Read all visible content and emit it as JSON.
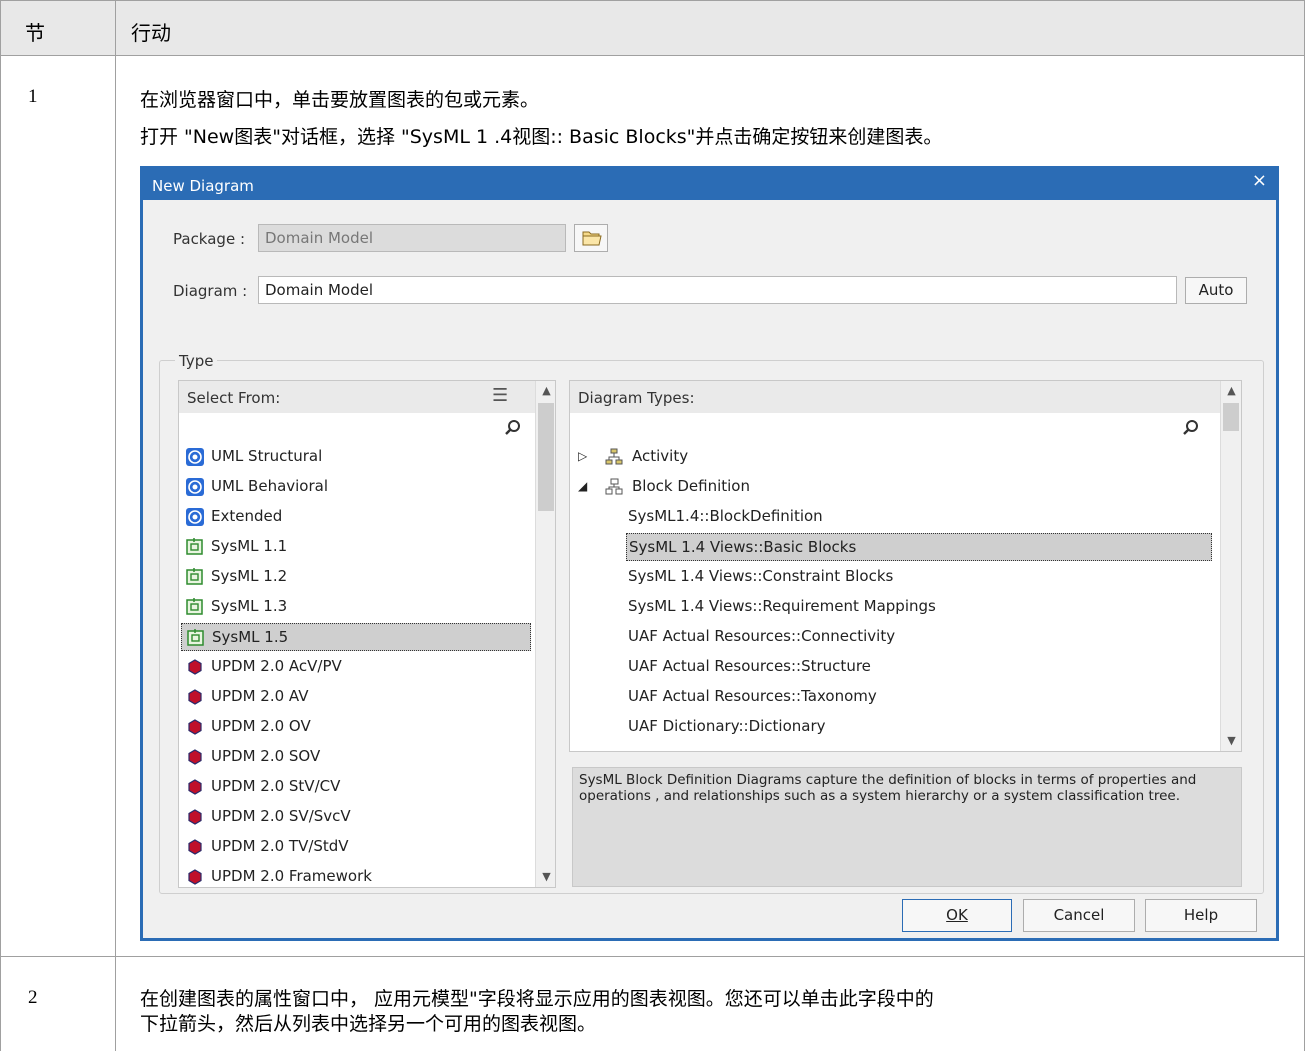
{
  "doc": {
    "col_step": "节",
    "col_action": "行动",
    "step1": {
      "num": "1",
      "line1": "在浏览器窗口中，单击要放置图表的包或元素。",
      "line2": "打开 \"New图表\"对话框，选择 \"SysML 1 .4视图:: Basic Blocks\"并点击确定按钮来创建图表。"
    },
    "step2": {
      "num": "2",
      "line1": "在创建图表的属性窗口中， 应用元模型\"字段将显示应用的图表视图。您还可以单击此字段中的",
      "line2": "下拉箭头，然后从列表中选择另一个可用的图表视图。"
    }
  },
  "dialog": {
    "title": "New Diagram",
    "close": "×",
    "package_label": "Package :",
    "package_value": "Domain Model",
    "diagram_label": "Diagram :",
    "diagram_value": "Domain Model",
    "auto_button": "Auto",
    "type_group": "Type",
    "select_from_header": "Select From:",
    "diagram_types_header": "Diagram Types:",
    "select_from_items": [
      {
        "label": "UML Structural",
        "icon": "uml-icon"
      },
      {
        "label": "UML Behavioral",
        "icon": "uml-icon"
      },
      {
        "label": "Extended",
        "icon": "uml-icon"
      },
      {
        "label": "SysML 1.1",
        "icon": "sysml-icon"
      },
      {
        "label": "SysML 1.2",
        "icon": "sysml-icon"
      },
      {
        "label": "SysML 1.3",
        "icon": "sysml-icon"
      },
      {
        "label": "SysML 1.5",
        "icon": "sysml-icon",
        "selected": true
      },
      {
        "label": "UPDM 2.0 AcV/PV",
        "icon": "updm-icon"
      },
      {
        "label": "UPDM 2.0 AV",
        "icon": "updm-icon"
      },
      {
        "label": "UPDM 2.0 OV",
        "icon": "updm-icon"
      },
      {
        "label": "UPDM 2.0 SOV",
        "icon": "updm-icon"
      },
      {
        "label": "UPDM 2.0 StV/CV",
        "icon": "updm-icon"
      },
      {
        "label": "UPDM 2.0 SV/SvcV",
        "icon": "updm-icon"
      },
      {
        "label": "UPDM 2.0 TV/StdV",
        "icon": "updm-icon"
      },
      {
        "label": "UPDM 2.0 Framework",
        "icon": "updm-icon"
      }
    ],
    "diagram_types": [
      {
        "label": "Activity",
        "kind": "group",
        "expanded": false
      },
      {
        "label": "Block Definition",
        "kind": "group",
        "expanded": true
      },
      {
        "label": "SysML1.4::BlockDefinition",
        "kind": "item"
      },
      {
        "label": "SysML 1.4 Views::Basic Blocks",
        "kind": "item",
        "selected": true
      },
      {
        "label": "SysML 1.4 Views::Constraint Blocks",
        "kind": "item"
      },
      {
        "label": "SysML 1.4 Views::Requirement Mappings",
        "kind": "item"
      },
      {
        "label": "UAF Actual Resources::Connectivity",
        "kind": "item"
      },
      {
        "label": "UAF Actual Resources::Structure",
        "kind": "item"
      },
      {
        "label": "UAF Actual Resources::Taxonomy",
        "kind": "item"
      },
      {
        "label": "UAF Dictionary::Dictionary",
        "kind": "item"
      }
    ],
    "description": "SysML Block Definition Diagrams capture the definition of blocks in terms of properties and operations , and relationships such as a system hierarchy or a system classification tree.",
    "ok_button": "OK",
    "cancel_button": "Cancel",
    "help_button": "Help",
    "colors": {
      "title_bar": "#2b6cb5",
      "selection": "#cfcfcf"
    }
  }
}
